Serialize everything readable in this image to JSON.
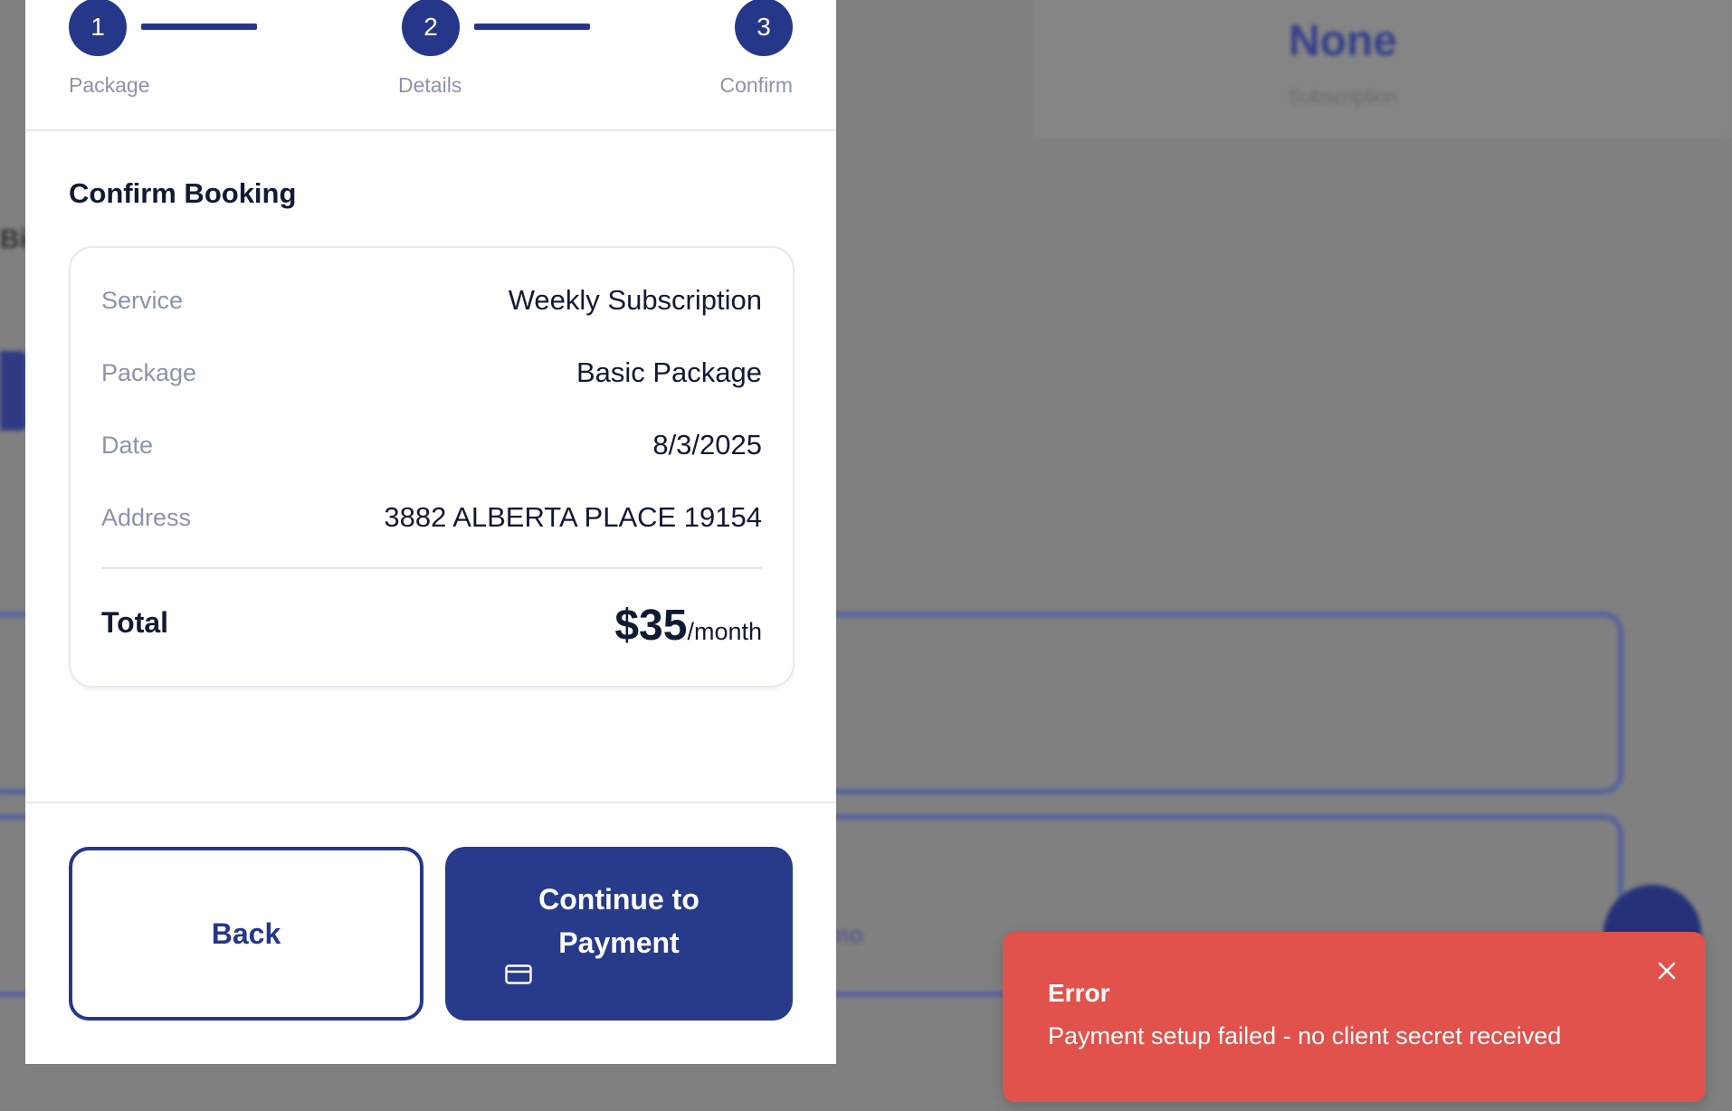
{
  "background": {
    "plan_value": "None",
    "plan_caption": "Subscription",
    "section_heading": "Bi",
    "billing_label": "Billing",
    "second_card_label": "Book Demo"
  },
  "stepper": {
    "steps": [
      {
        "number": "1",
        "label": "Package"
      },
      {
        "number": "2",
        "label": "Details"
      },
      {
        "number": "3",
        "label": "Confirm"
      }
    ]
  },
  "confirm": {
    "title": "Confirm Booking",
    "rows": [
      {
        "label": "Service",
        "value": "Weekly Subscription"
      },
      {
        "label": "Package",
        "value": "Basic Package"
      },
      {
        "label": "Date",
        "value": "8/3/2025"
      },
      {
        "label": "Address",
        "value": "3882 ALBERTA PLACE 19154"
      }
    ],
    "total_label": "Total",
    "total_amount": "$35",
    "total_period": "/month"
  },
  "actions": {
    "back_label": "Back",
    "continue_line1": "Continue to",
    "continue_line2": "Payment",
    "continue_icon": "credit-card-icon"
  },
  "toast": {
    "title": "Error",
    "message": "Payment setup failed - no client secret received",
    "close_icon": "close-icon"
  },
  "colors": {
    "primary": "#26378a",
    "error": "#e0524b",
    "muted_text": "#8a94aa",
    "overlay": "#808080"
  }
}
